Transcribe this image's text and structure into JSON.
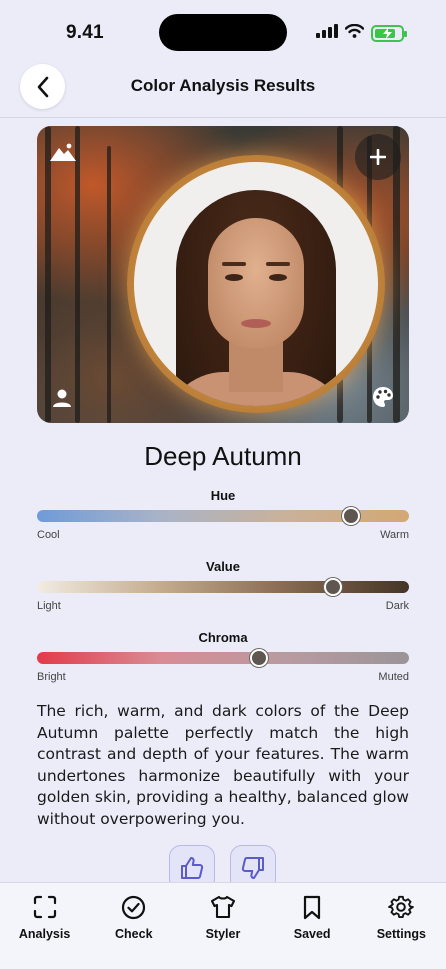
{
  "status_bar": {
    "time": "9.41"
  },
  "header": {
    "title": "Color Analysis Results"
  },
  "result": {
    "season": "Deep Autumn"
  },
  "scales": {
    "hue": {
      "title": "Hue",
      "min_label": "Cool",
      "max_label": "Warm",
      "level": 0.845
    },
    "value": {
      "title": "Value",
      "min_label": "Light",
      "max_label": "Dark",
      "level": 0.797
    },
    "chroma": {
      "title": "Chroma",
      "min_label": "Bright",
      "max_label": "Muted",
      "level": 0.598
    }
  },
  "description": "The rich, warm, and dark colors of the Deep Autumn palette perfectly match the high contrast and depth of your features. The warm undertones harmonize beautifully with your golden skin, providing a healthy, balanced glow without overpowering you.",
  "colors": {
    "accent": "#5b5bc9",
    "background": "#ececf9",
    "battery": "#3fc24e"
  },
  "tabs": [
    {
      "label": "Analysis",
      "icon": "scan-frame-icon"
    },
    {
      "label": "Check",
      "icon": "check-circle-icon"
    },
    {
      "label": "Styler",
      "icon": "shirt-icon"
    },
    {
      "label": "Saved",
      "icon": "bookmark-icon"
    },
    {
      "label": "Settings",
      "icon": "gear-icon"
    }
  ]
}
